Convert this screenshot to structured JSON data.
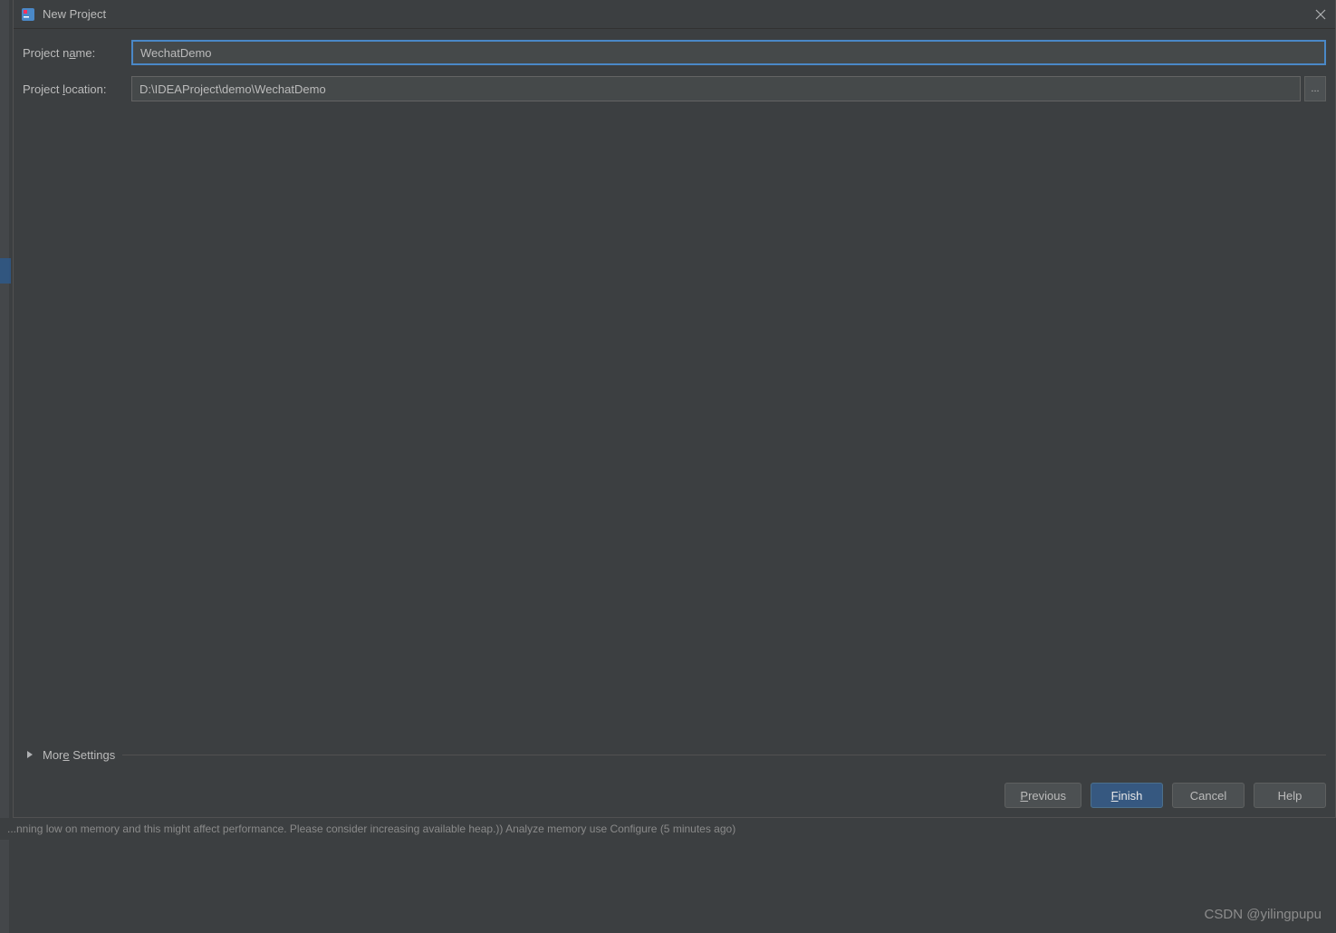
{
  "dialog": {
    "title": "New Project"
  },
  "form": {
    "project_name_label": "Project name:",
    "project_name_value": "WechatDemo",
    "project_location_label": "Project location:",
    "project_location_value": "D:\\IDEAProject\\demo\\WechatDemo",
    "browse_label": "..."
  },
  "more_settings": {
    "label": "More Settings"
  },
  "buttons": {
    "previous": "Previous",
    "finish": "Finish",
    "cancel": "Cancel",
    "help": "Help"
  },
  "status_bar": {
    "text": "...nning low on memory and this might affect performance. Please consider increasing available heap.)) Analyze memory use   Configure (5 minutes ago)"
  },
  "watermark": "CSDN @yilingpupu"
}
